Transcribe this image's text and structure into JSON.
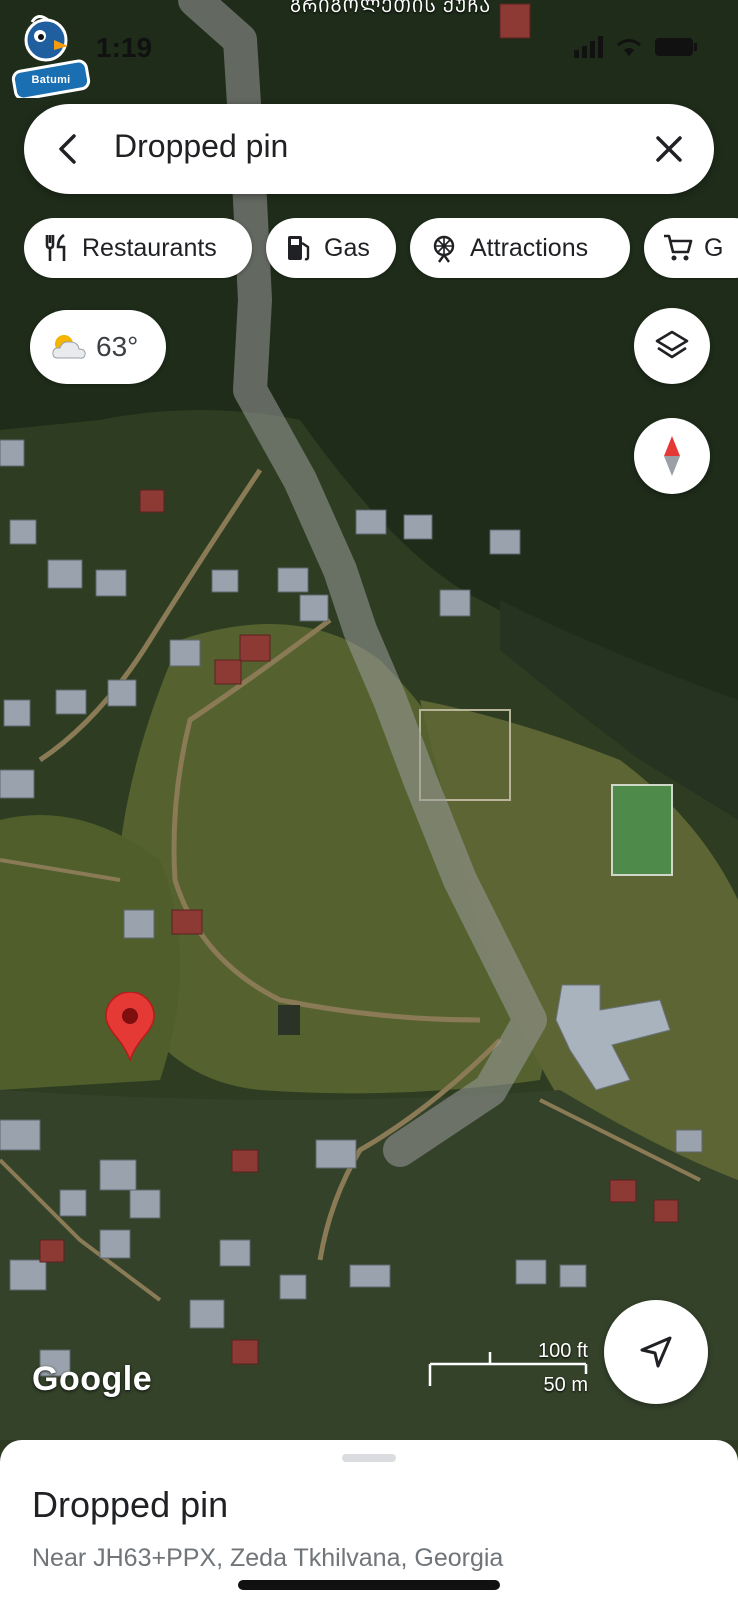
{
  "status_bar": {
    "time": "1:19"
  },
  "top_street_label": "ᲒᲠᲘᲒᲝᲚᲔᲗᲘᲡ ᲥᲣᲩᲐ",
  "watermark": {
    "brand": "Batumi"
  },
  "search": {
    "query": "Dropped pin"
  },
  "chips": [
    {
      "label": "Restaurants",
      "icon": "restaurant-icon"
    },
    {
      "label": "Gas",
      "icon": "gas-station-icon"
    },
    {
      "label": "Attractions",
      "icon": "attractions-icon"
    },
    {
      "label": "G",
      "icon": "shopping-cart-icon"
    }
  ],
  "weather": {
    "temperature": "63°",
    "icon": "partly-cloudy-icon"
  },
  "map": {
    "attribution": "Google",
    "scale_imperial": "100 ft",
    "scale_metric": "50 m",
    "pin_color": "#e53935"
  },
  "place_sheet": {
    "title": "Dropped pin",
    "address": "Near JH63+PPX, Zeda Tkhilvana, Georgia"
  }
}
